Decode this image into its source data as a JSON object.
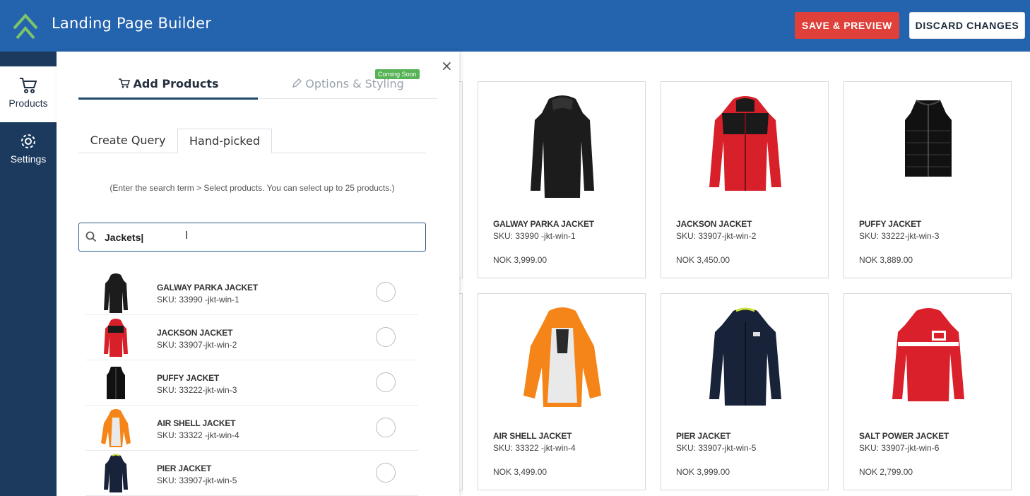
{
  "app": {
    "title": "Landing Page Builder"
  },
  "header": {
    "save_label": "SAVE & PREVIEW",
    "discard_label": "DISCARD CHANGES"
  },
  "leftnav": {
    "items": [
      {
        "label": "Products",
        "icon": "cart-icon"
      },
      {
        "label": "Settings",
        "icon": "gear-icon"
      }
    ]
  },
  "panel": {
    "tabs": [
      {
        "label": "Add Products",
        "icon": "cart-icon"
      },
      {
        "label": "Options & Styling",
        "icon": "pencil-icon",
        "badge": "Coming Soon"
      }
    ],
    "subtabs": [
      "Create Query",
      "Hand-picked"
    ],
    "hint": "(Enter the search term > Select products. You can select up to 25 products.)",
    "search": {
      "value": "Jackets|"
    },
    "results": [
      {
        "name": "GALWAY PARKA JACKET",
        "sku": "SKU: 33990 -jkt-win-1"
      },
      {
        "name": "JACKSON JACKET",
        "sku": "SKU: 33907-jkt-win-2"
      },
      {
        "name": "PUFFY JACKET",
        "sku": "SKU: 33222-jkt-win-3"
      },
      {
        "name": "AIR SHELL JACKET",
        "sku": "SKU: 33322 -jkt-win-4"
      },
      {
        "name": "PIER JACKET",
        "sku": "SKU: 33907-jkt-win-5"
      }
    ]
  },
  "grid": {
    "cards": [
      {
        "name": "GALWAY PARKA JACKET",
        "sku": "SKU: 33990 -jkt-win-1",
        "price": "NOK 3,999.00"
      },
      {
        "name": "JACKSON JACKET",
        "sku": "SKU: 33907-jkt-win-2",
        "price": "NOK 3,450.00"
      },
      {
        "name": "PUFFY JACKET",
        "sku": "SKU: 33222-jkt-win-3",
        "price": "NOK 3,889.00"
      },
      {
        "name": "AIR SHELL JACKET",
        "sku": "SKU: 33322 -jkt-win-4",
        "price": "NOK 3,499.00"
      },
      {
        "name": "PIER JACKET",
        "sku": "SKU: 33907-jkt-win-5",
        "price": "NOK 3,999.00"
      },
      {
        "name": "SALT POWER JACKET",
        "sku": "SKU: 33907-jkt-win-6",
        "price": "NOK 2,799.00"
      }
    ]
  },
  "colors": {
    "header": "#2463ad",
    "nav": "#1b3a5e",
    "save": "#e0403a",
    "badge": "#56b356"
  }
}
